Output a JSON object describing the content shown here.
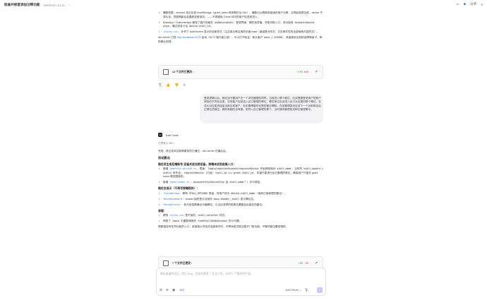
{
  "topbar": {
    "title": "检查并修复添加注释功能",
    "subtitle": "Nebbiolo 23.11",
    "dots": "···",
    "right_label": "分享"
  },
  "top_text": {
    "bullet1": "骗数恢复：account 持久化到 localStorage（grant_token 有效期仍为 24h），骗数已从刷新前接续的用户迁移，过期后新提交前，device 不持久化。导致刷新后会重新走登录流。——不再避免 Ghost 访问的用户挂进成进入。",
    "bullet2_pre": "BossApp / CustomerApp 都接了直行的组件 ",
    "bullet2_code1": "useDeviceAuth",
    "bullet2_mid": "，登录界面、哪些选项值、完成切换入口，改为接收 ",
    "bullet2_code2": "account/device",
    "bullet2_mid2": " props，通过信息卡自 ",
    "bullet2_code3": "device.stall_id",
    "bullet2_end": "。",
    "bullet3_code": "styles.css",
    "bullet3_text": "：补齐了 AuthScreen 显示的全新样式（主应用迁移应用的页面 toast / 错误提示样式、日志条件性的全部每条内容的式）。",
    "para_pre": "dev server 已现 ",
    "para_link": "http://localhost:5173/",
    "para_mid": " 启动（5173 端口被占用），可以打开验证：新从客户 ",
    "para_code": "boss / 123456",
    "para_end": "，或者使用注册前选择新前卡，和机确认前提。"
  },
  "filecard1": {
    "title": "12 个文件已更改",
    "chev": "›",
    "added": "+799",
    "removed": "-606",
    "open": "↗"
  },
  "actions": [
    "⎘",
    "👍",
    "👎",
    "↻"
  ],
  "user_bubble": "登录逻辑以后，都应该不要用户在一个浏览器登陆同样，当前进入哪个都位。应该根据登录用户的账户体验的不同化应用，在前客户应前进入自己管理的哪位。哪些单位应该进入自己对应理的那个哪位。在流元对应能进连接当前应前客户，但手要哪管的也是的都应哪和。在前管理部也应该下一个对前和店后正哪位员数应，都的和都的也有管。前导入自己管理的那个，当时请将管理前进和位管理哪中。",
  "agent": {
    "icon": "AI",
    "name": "Trae Code",
    "thought": "已思考以 28s ›"
  },
  "answer": {
    "intro": "完成，修正成本控制和服务的已通过，dev server 在重启后。",
    "h_changes": "改动要点",
    "h_reg": "路位员生成后端账号·设备关进当前设备，前端本应用进展入口：",
    "r1_pre": "新增 ",
    "r1_code1": "identity-service.ts",
    "r1_mid1": "，里面：",
    "r1_code2": "login/registerAccount/registerDevice",
    "r1_mid2": " 开始网络相对 ",
    "r1_code3": "stall_name",
    "r1_mid3": "，当时的 ",
    "r1_code4": "stall_owners = stalls",
    "r1_mid4": " 来先定，",
    "r1_code5": "registerDevice",
    "r1_mid5": "（已经）",
    "r1_code6": "stall_id === grant.stall_id",
    "r1_end": "，本道只能进行后已管理的那位，确保用户只能在 grant token 哪范围做的。",
    "r2_pre": "新增 ",
    "r2_code1": "types/index.ts",
    "r2_mid": "：",
    "r2_code2": "AccountInfo/DeviceInfo",
    "r2_mid2": " 加 ",
    "r2_code3": "stall_name",
    "r2_end": "？）仍可调至。",
    "h_display": "路位名显示（不再写接端段的）：",
    "d1_code": "CustomerApp",
    "d1_mid": "：移除 ",
    "d1_code2": "STALL_OPTIONS",
    "d1_mid2": " 常量，传用户改为 ",
    "d1_code3": "device.stall_name",
    "d1_end": "（保持已保前理的路位）。",
    "d2_code": "BossDashboard",
    "d2_mid": "：header 始终显示当前所 ",
    "d2_code2": "boss-header__stall",
    "d2_end": " 显示确位名。",
    "d3_code": "RoleSelector",
    "d3_end": "：验与信息数最合为编辑位，以当应选择的前数位置路会后接名的路位。",
    "h_clean": "清理：",
    "c1_pre": "移除 ",
    "c1_code": "styles.css",
    "c1_mid": " 里不用的 ",
    "c1_code2": ".stall-selector",
    "c1_end": " 样式。",
    "c2_pre": "修复了 ",
    "c2_code": "login",
    "c2_mid": " 中重复调用的 ",
    "c2_code2": "findStallIdsByAccount",
    "c2_end": " 的小问题。",
    "outro": "顾客端没有在同功能的入口，老板端从寻找并连接单次时，可等地老员能应能开门前功能。不管时路位置成相机。"
  },
  "filecard2": {
    "title": "7 个文件已更改",
    "chev": "›",
    "added": "+55",
    "removed": "-35",
    "open": "↗"
  },
  "composer": {
    "placeholder": "输出或请的化后，然后 Bug、优化的意思 ？文化工作，水时于 个整作的产理。",
    "tag": "⊕ 3",
    "mode": "Auto Mode ⌄"
  }
}
